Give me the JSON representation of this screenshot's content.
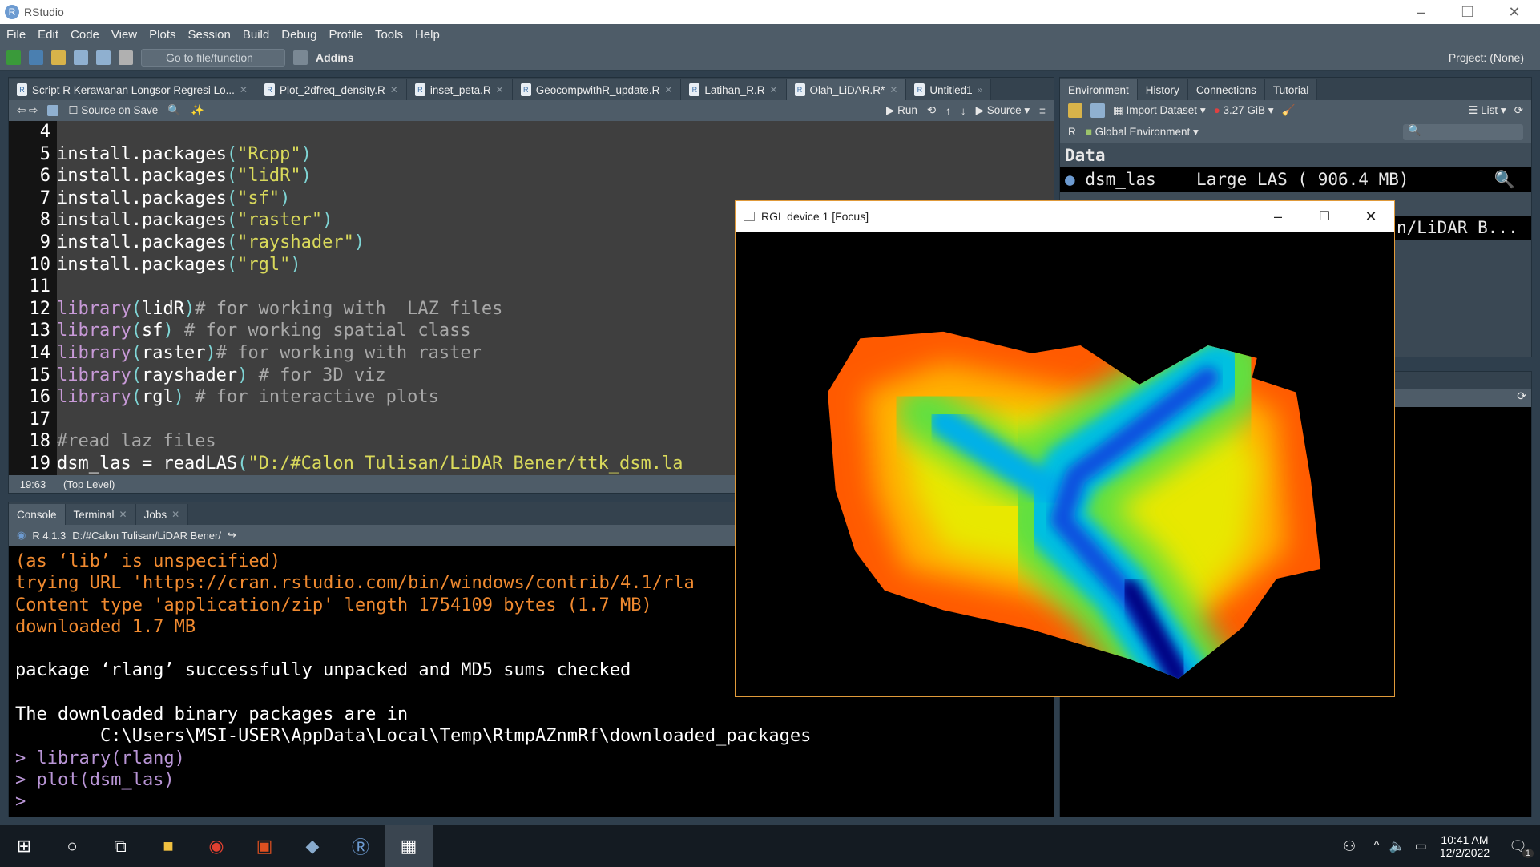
{
  "window": {
    "title": "RStudio"
  },
  "menu": [
    "File",
    "Edit",
    "Code",
    "View",
    "Plots",
    "Session",
    "Build",
    "Debug",
    "Profile",
    "Tools",
    "Help"
  ],
  "toolbar": {
    "goto_placeholder": "Go to file/function",
    "addins": "Addins",
    "project": "Project: (None)"
  },
  "editor": {
    "tabs": [
      {
        "label": "Script R Kerawanan Longsor Regresi Lo..."
      },
      {
        "label": "Plot_2dfreq_density.R"
      },
      {
        "label": "inset_peta.R"
      },
      {
        "label": "GeocompwithR_update.R"
      },
      {
        "label": "Latihan_R.R"
      },
      {
        "label": "Olah_LiDAR.R*",
        "active": true
      },
      {
        "label": "Untitled1"
      }
    ],
    "toolbar": {
      "source_on_save": "Source on Save",
      "run": "Run",
      "source": "Source"
    },
    "lines": [
      {
        "n": "4",
        "parts": []
      },
      {
        "n": "5",
        "parts": [
          [
            "fn",
            "install.packages"
          ],
          [
            "par",
            "("
          ],
          [
            "str",
            "\"Rcpp\""
          ],
          [
            "par",
            ")"
          ]
        ]
      },
      {
        "n": "6",
        "parts": [
          [
            "fn",
            "install.packages"
          ],
          [
            "par",
            "("
          ],
          [
            "str",
            "\"lidR\""
          ],
          [
            "par",
            ")"
          ]
        ]
      },
      {
        "n": "7",
        "parts": [
          [
            "fn",
            "install.packages"
          ],
          [
            "par",
            "("
          ],
          [
            "str",
            "\"sf\""
          ],
          [
            "par",
            ")"
          ]
        ]
      },
      {
        "n": "8",
        "parts": [
          [
            "fn",
            "install.packages"
          ],
          [
            "par",
            "("
          ],
          [
            "str",
            "\"raster\""
          ],
          [
            "par",
            ")"
          ]
        ]
      },
      {
        "n": "9",
        "parts": [
          [
            "fn",
            "install.packages"
          ],
          [
            "par",
            "("
          ],
          [
            "str",
            "\"rayshader\""
          ],
          [
            "par",
            ")"
          ]
        ]
      },
      {
        "n": "10",
        "parts": [
          [
            "fn",
            "install.packages"
          ],
          [
            "par",
            "("
          ],
          [
            "str",
            "\"rgl\""
          ],
          [
            "par",
            ")"
          ]
        ]
      },
      {
        "n": "11",
        "parts": []
      },
      {
        "n": "12",
        "parts": [
          [
            "kw",
            "library"
          ],
          [
            "par",
            "("
          ],
          [
            "fn",
            "lidR"
          ],
          [
            "par",
            ")"
          ],
          [
            "cm",
            "# for working with  LAZ files"
          ]
        ]
      },
      {
        "n": "13",
        "parts": [
          [
            "kw",
            "library"
          ],
          [
            "par",
            "("
          ],
          [
            "fn",
            "sf"
          ],
          [
            "par",
            ")"
          ],
          [
            "cm",
            " # for working spatial class"
          ]
        ]
      },
      {
        "n": "14",
        "parts": [
          [
            "kw",
            "library"
          ],
          [
            "par",
            "("
          ],
          [
            "fn",
            "raster"
          ],
          [
            "par",
            ")"
          ],
          [
            "cm",
            "# for working with raster"
          ]
        ]
      },
      {
        "n": "15",
        "parts": [
          [
            "kw",
            "library"
          ],
          [
            "par",
            "("
          ],
          [
            "fn",
            "rayshader"
          ],
          [
            "par",
            ")"
          ],
          [
            "cm",
            " # for 3D viz"
          ]
        ]
      },
      {
        "n": "16",
        "parts": [
          [
            "kw",
            "library"
          ],
          [
            "par",
            "("
          ],
          [
            "fn",
            "rgl"
          ],
          [
            "par",
            ")"
          ],
          [
            "cm",
            " # for interactive plots"
          ]
        ]
      },
      {
        "n": "17",
        "parts": []
      },
      {
        "n": "18",
        "parts": [
          [
            "cm",
            "#read laz files"
          ]
        ]
      },
      {
        "n": "19",
        "parts": [
          [
            "fn",
            "dsm_las = readLAS"
          ],
          [
            "par",
            "("
          ],
          [
            "str",
            "\"D:/#Calon Tulisan/LiDAR Bener/ttk_dsm.la"
          ]
        ]
      }
    ],
    "status": {
      "position": "19:63",
      "scope": "(Top Level)"
    }
  },
  "console": {
    "tabs": [
      "Console",
      "Terminal",
      "Jobs"
    ],
    "r_version": "R 4.1.3",
    "wd": "D:/#Calon Tulisan/LiDAR Bener/",
    "lines": [
      [
        "or",
        "(as ‘lib’ is unspecified)"
      ],
      [
        "or",
        "trying URL 'https://cran.rstudio.com/bin/windows/contrib/4.1/rla"
      ],
      [
        "or",
        "Content type 'application/zip' length 1754109 bytes (1.7 MB)"
      ],
      [
        "or",
        "downloaded 1.7 MB"
      ],
      [
        "wh",
        ""
      ],
      [
        "wh",
        "package ‘rlang’ successfully unpacked and MD5 sums checked"
      ],
      [
        "wh",
        ""
      ],
      [
        "wh",
        "The downloaded binary packages are in"
      ],
      [
        "wh",
        "        C:\\Users\\MSI-USER\\AppData\\Local\\Temp\\RtmpAZnmRf\\downloaded_packages"
      ],
      [
        "pu",
        "> library(rlang)"
      ],
      [
        "pu",
        "> plot(dsm_las)"
      ],
      [
        "pu",
        "> "
      ]
    ]
  },
  "environment": {
    "tabs": [
      "Environment",
      "History",
      "Connections",
      "Tutorial"
    ],
    "import_dataset": "Import Dataset",
    "memory": "3.27 GiB",
    "view": "List",
    "language": "R",
    "scope": "Global Environment",
    "section": "Data",
    "rows": [
      {
        "name": "dsm_las",
        "value": "Large LAS ( 906.4 MB)"
      }
    ],
    "partial_row": "n/LiDAR B..."
  },
  "rgl": {
    "title": "RGL device 1 [Focus]"
  },
  "taskbar": {
    "time": "10:41 AM",
    "date": "12/2/2022",
    "notifications": "1"
  },
  "colors": {
    "accent": "#4e5c68",
    "console_output": "#f08a30",
    "string": "#d9d95b",
    "keyword": "#c89ad8"
  }
}
